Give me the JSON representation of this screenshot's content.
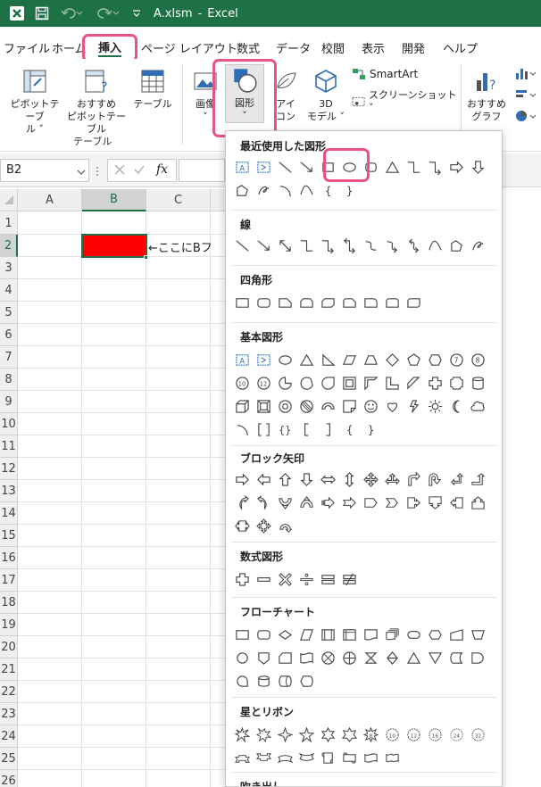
{
  "title_bar": {
    "filename": "A.xlsm",
    "separator": "-",
    "app_name": "Excel"
  },
  "tabs": [
    "ファイル",
    "ホーム",
    "挿入",
    "ページ レイアウト",
    "数式",
    "データ",
    "校閲",
    "表示",
    "開発",
    "ヘルプ"
  ],
  "active_tab": "挿入",
  "ribbon": {
    "pivot_table": [
      "ピボットテーブ",
      "ル ˅"
    ],
    "recommended_pivot": [
      "おすすめ",
      "ピボットテーブル"
    ],
    "table": "テーブル",
    "group_table": "テーブル",
    "image": [
      "画像",
      "˅"
    ],
    "shapes": [
      "図形",
      "˅"
    ],
    "icons": [
      "アイ",
      "コン"
    ],
    "model3d": [
      "3D",
      "モデル ˅"
    ],
    "smartart": "SmartArt",
    "screenshot": "スクリーンショット ˅",
    "recommended_charts": [
      "おすすめ",
      "グラフ"
    ]
  },
  "formula_bar": {
    "name_box": "B2",
    "fx": "fx"
  },
  "grid": {
    "columns": [
      "A",
      "B",
      "C"
    ],
    "rows": [
      "1",
      "2",
      "3",
      "4",
      "5",
      "6",
      "7",
      "8",
      "9",
      "10",
      "11",
      "12",
      "13",
      "14",
      "15",
      "16",
      "17",
      "18",
      "19",
      "20",
      "21",
      "22",
      "23",
      "24",
      "25",
      "26"
    ],
    "annotation_text": "←ここにBフ",
    "highlight_color": "#ff0000"
  },
  "shapes_menu": {
    "sections": [
      "最近使用した図形",
      "線",
      "四角形",
      "基本図形",
      "ブロック矢印",
      "数式図形",
      "フローチャート",
      "星とリボン",
      "吹き出し"
    ]
  },
  "colors": {
    "excel_green": "#1e7145",
    "accent_pink": "#e8528a"
  }
}
